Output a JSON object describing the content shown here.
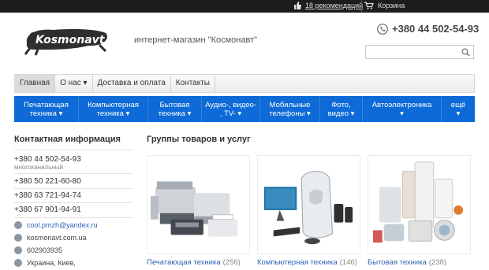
{
  "topbar": {
    "recommendations": "18 рекомендаций",
    "cart": "Корзина"
  },
  "header": {
    "logo_text": "Kosmonavt",
    "tagline": "интернет-магазин \"Космонавт\"",
    "phone": "+380 44 502-54-93",
    "search_placeholder": ""
  },
  "nav_primary": [
    {
      "label": "Главная",
      "active": true
    },
    {
      "label": "О нас ▾",
      "active": false
    },
    {
      "label": "Доставка и оплата",
      "active": false
    },
    {
      "label": "Контакты",
      "active": false
    }
  ],
  "nav_categories": [
    {
      "l1": "Печатающая",
      "l2": "техника ▾"
    },
    {
      "l1": "Компьютерная",
      "l2": "техника ▾"
    },
    {
      "l1": "Бытовая",
      "l2": "техника ▾"
    },
    {
      "l1": "Аудио-, видео-",
      "l2": ", TV- ▾"
    },
    {
      "l1": "Мобильные",
      "l2": "телефоны ▾"
    },
    {
      "l1": "Фото,",
      "l2": "видео ▾"
    },
    {
      "l1": "Автоэлектроника",
      "l2": "▾"
    },
    {
      "l1": "ещё",
      "l2": "▾"
    }
  ],
  "sidebar": {
    "title": "Контактная информация",
    "phones": [
      "+380 44 502-54-93",
      "+380 50 221-60-80",
      "+380 63 721-94-74",
      "+380 67 901-94-91"
    ],
    "multichannel": "многоканальный",
    "email": "cool.pmzh@yandex.ru",
    "site": "kosmonavt.com.ua",
    "icq": "602903935",
    "address": "Украина, Киев,"
  },
  "main": {
    "title": "Группы товаров и услуг",
    "groups": [
      {
        "name": "Печатающая техника",
        "count": "(256)"
      },
      {
        "name": "Компьютерная техника",
        "count": "(146)"
      },
      {
        "name": "Бытовая техника",
        "count": "(238)"
      }
    ]
  },
  "colors": {
    "topbar": "#1d1d1d",
    "category_bar": "#0d6ad6",
    "link": "#2a64b8"
  }
}
